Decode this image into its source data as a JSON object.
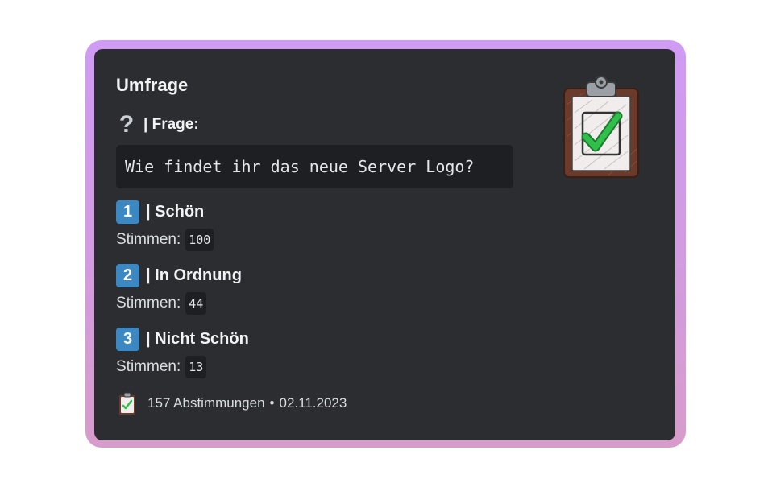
{
  "embed": {
    "title": "Umfrage",
    "question_icon": "question-mark-icon",
    "question_label": "| Frage:",
    "question_text": "Wie findet ihr das neue Server Logo?",
    "thumbnail_icon": "clipboard-check-icon",
    "options": [
      {
        "number": "1",
        "label": "| Schön",
        "votes_label": "Stimmen:",
        "votes": "100"
      },
      {
        "number": "2",
        "label": "| In Ordnung",
        "votes_label": "Stimmen:",
        "votes": "44"
      },
      {
        "number": "3",
        "label": "| Nicht Schön",
        "votes_label": "Stimmen:",
        "votes": "13"
      }
    ],
    "footer": {
      "icon": "clipboard-check-icon",
      "text": "157 Abstimmungen",
      "separator": "•",
      "date": "02.11.2023"
    }
  },
  "colors": {
    "card_background": "#2b2d31",
    "frame_gradient_top": "#cf9bf4",
    "frame_gradient_bottom": "#d79ccb",
    "number_badge": "#3b88c3",
    "check_green": "#2fbf4a"
  }
}
